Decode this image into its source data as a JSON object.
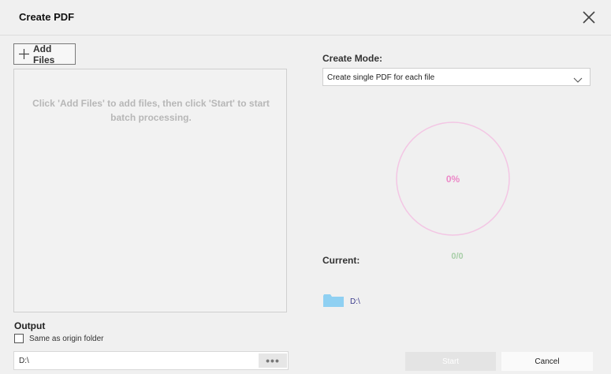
{
  "dialog": {
    "title": "Create PDF"
  },
  "left_panel": {
    "add_files_label": "Add Files",
    "hint": "Click 'Add Files' to add files, then click 'Start' to start batch processing.",
    "output_label": "Output",
    "same_origin_label": "Same as origin folder",
    "same_origin_checked": false,
    "output_path": "D:\\",
    "browse_label": "•••"
  },
  "right_panel": {
    "create_mode_label": "Create Mode:",
    "create_mode_value": "Create single PDF for each file",
    "progress_percent": "0%",
    "progress_value": 0,
    "count": "0/0",
    "current_label": "Current:",
    "current_path": "D:\\"
  },
  "footer": {
    "start_label": "Start",
    "cancel_label": "Cancel"
  },
  "colors": {
    "ring": "#f3c6e4",
    "percent": "#ec89c8",
    "count": "#a9cfa9",
    "folder": "#8fd0f2"
  },
  "icons": [
    "close-icon",
    "plus-icon",
    "chevron-down-icon",
    "folder-icon"
  ]
}
